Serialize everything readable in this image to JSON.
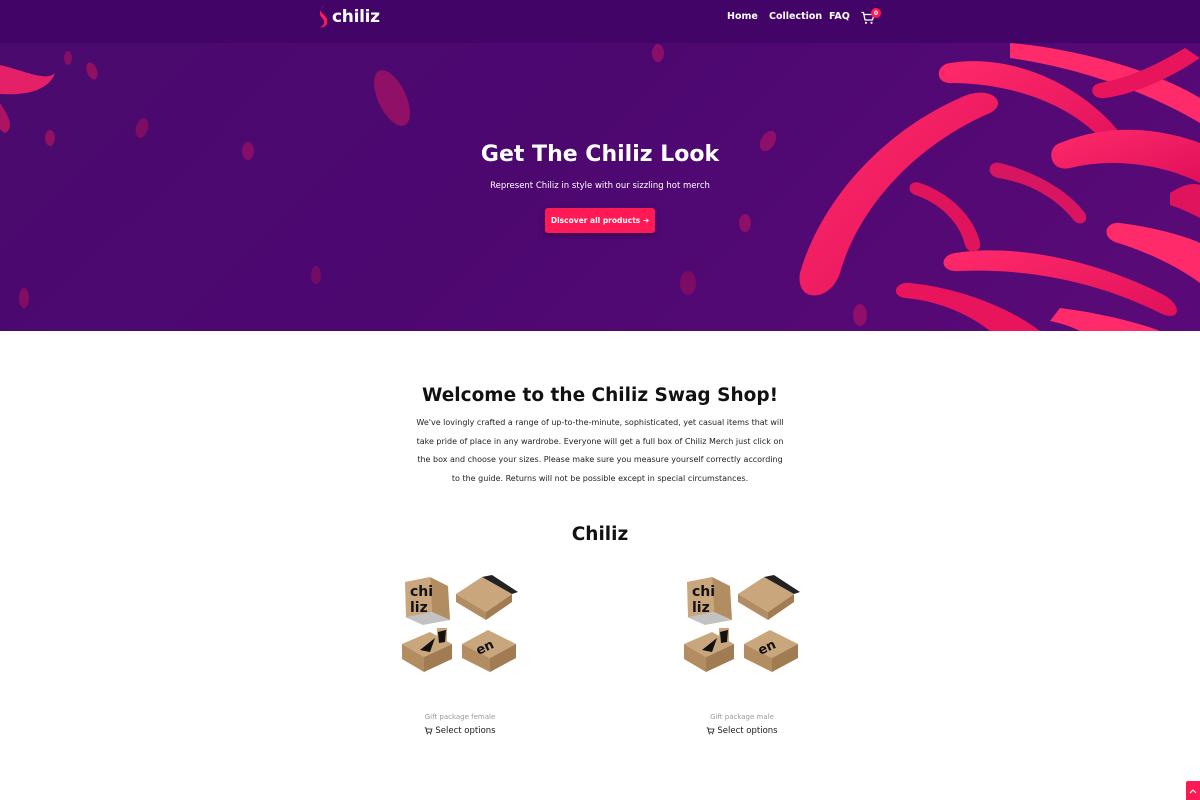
{
  "header": {
    "logo_text": "chiliz",
    "nav": [
      {
        "label": "Home"
      },
      {
        "label": "Collection"
      },
      {
        "label": "FAQ"
      }
    ],
    "cart_count": "0",
    "cart_icon": "shopping-cart-icon"
  },
  "hero": {
    "title": "Get The Chiliz Look",
    "subtitle": "Represent Chiliz in style with our sizzling hot merch",
    "button_label": "Discover all products ➔"
  },
  "welcome": {
    "title": "Welcome to the Chiliz Swag Shop!",
    "text": "We've lovingly crafted a range of up-to-the-minute, sophisticated, yet casual items that will take pride of place in any wardrobe. Everyone will get a full box of Chiliz Merch just click on the box and choose your sizes. Please make sure you measure yourself correctly according to the guide. Returns will not be possible except in special circumstances."
  },
  "collection": {
    "title": "Chiliz",
    "products": [
      {
        "name": "Gift package female",
        "action": "Select options"
      },
      {
        "name": "Gift package male",
        "action": "Select options"
      }
    ]
  },
  "colors": {
    "brand_purple": "#430467",
    "accent_pink": "#ff1a55"
  }
}
